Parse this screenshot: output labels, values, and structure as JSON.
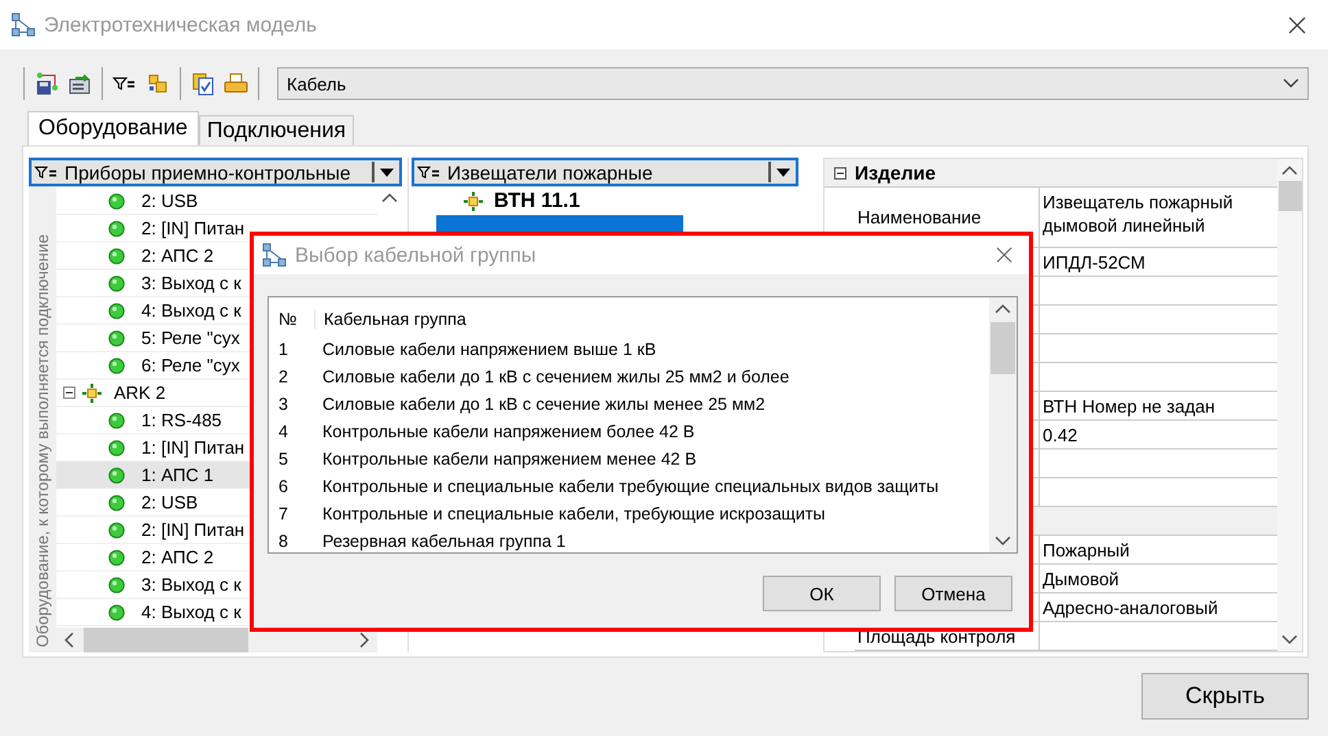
{
  "window": {
    "title": "Электротехническая модель"
  },
  "toolbar": {
    "dropdown": "Кабель"
  },
  "tabs": [
    {
      "label": "Оборудование",
      "selected": true
    },
    {
      "label": "Подключения",
      "selected": false
    }
  ],
  "left_panel": {
    "filter": "Приборы приемно-контрольные",
    "side_label": "Оборудование, к которому выполняется подключение",
    "tree": [
      {
        "children": [
          {
            "label": "2: USB",
            "selected": false
          },
          {
            "label": "2: [IN] Питан",
            "selected": false
          },
          {
            "label": "2: АПС 2",
            "selected": false
          },
          {
            "label": "3: Выход с к",
            "selected": false
          },
          {
            "label": "4: Выход с к",
            "selected": false
          },
          {
            "label": "5: Реле \"сух",
            "selected": false
          },
          {
            "label": "6: Реле \"сух",
            "selected": false
          }
        ]
      },
      {
        "label": "ARK 2",
        "expanded": true,
        "children": [
          {
            "label": "1: RS-485",
            "selected": false
          },
          {
            "label": "1: [IN] Питан",
            "selected": false
          },
          {
            "label": "1: АПС 1",
            "selected": true
          },
          {
            "label": "2: USB",
            "selected": false
          },
          {
            "label": "2: [IN] Питан",
            "selected": false
          },
          {
            "label": "2: АПС 2",
            "selected": false
          },
          {
            "label": "3: Выход с к",
            "selected": false
          },
          {
            "label": "4: Выход с к",
            "selected": false
          }
        ]
      }
    ]
  },
  "middle_panel": {
    "filter": "Извещатели пожарные",
    "items": [
      {
        "label": "ВТН 11.1",
        "selected": false
      },
      {
        "selected": true
      }
    ]
  },
  "properties": [
    {
      "kind": "section",
      "label": "Изделие",
      "expanded": true
    },
    {
      "kind": "row",
      "name": "Наименование",
      "value": "Извещатель пожарный дымовой линейный"
    },
    {
      "kind": "row",
      "value": "ИПДЛ-52СМ"
    },
    {
      "kind": "row"
    },
    {
      "kind": "row"
    },
    {
      "kind": "row"
    },
    {
      "kind": "row"
    },
    {
      "kind": "row",
      "value": "ВТН Номер не задан"
    },
    {
      "kind": "row",
      "value": "0.42"
    },
    {
      "kind": "row"
    },
    {
      "kind": "row"
    },
    {
      "kind": "section"
    },
    {
      "kind": "row",
      "value": "Пожарный"
    },
    {
      "kind": "row",
      "value": "Дымовой"
    },
    {
      "kind": "row",
      "value": "Адресно-аналоговый"
    },
    {
      "kind": "row",
      "name": "Площадь контроля"
    }
  ],
  "hide_button": "Скрыть",
  "dialog": {
    "title": "Выбор кабельной группы",
    "columns": [
      "№",
      "Кабельная группа"
    ],
    "rows": [
      [
        "1",
        "Силовые кабели напряжением выше 1 кВ"
      ],
      [
        "2",
        "Силовые кабели до 1 кВ с сечением жилы 25 мм2 и более"
      ],
      [
        "3",
        "Силовые кабели до 1 кВ с сечение жилы менее 25 мм2"
      ],
      [
        "4",
        "Контрольные кабели напряжением более 42 В"
      ],
      [
        "5",
        "Контрольные кабели напряжением менее 42 В"
      ],
      [
        "6",
        "Контрольные и специальные кабели требующие специальных видов защиты"
      ],
      [
        "7",
        "Контрольные и специальные кабели, требующие искрозащиты"
      ],
      [
        "8",
        "Резервная кабельная группа 1"
      ]
    ],
    "buttons": [
      "ОК",
      "Отмена"
    ]
  }
}
